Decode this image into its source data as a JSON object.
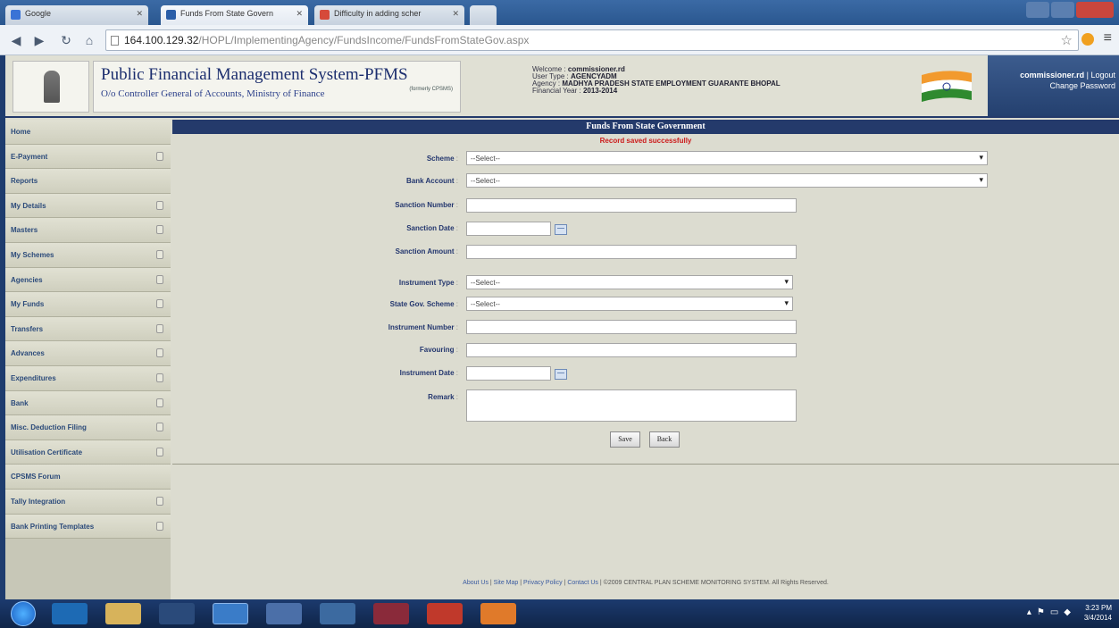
{
  "browser": {
    "tabs": [
      {
        "title": "Google",
        "color": "#3a73d6"
      },
      {
        "title": "Funds From State Govern",
        "color": "#2a5ea8"
      },
      {
        "title": "Difficulty in adding scher",
        "color": "#d64a3a"
      }
    ],
    "url_host": "164.100.129.32",
    "url_path": "/HOPL/ImplementingAgency/FundsIncome/FundsFromStateGov.aspx"
  },
  "header": {
    "title": "Public Financial Management System-PFMS",
    "subtitle": "O/o Controller General of Accounts, Ministry of Finance",
    "formerly": "(formerly CPSMS)",
    "welcome_label": "Welcome :",
    "welcome_value": "commissioner.rd",
    "user_type_label": "User Type :",
    "user_type_value": "AGENCYADM",
    "agency_label": "Agency :",
    "agency_value": "MADHYA PRADESH STATE EMPLOYMENT GUARANTE BHOPAL",
    "fy_label": "Financial Year :",
    "fy_value": "2013-2014",
    "user_link": "commissioner.rd",
    "logout": "Logout",
    "change_password": "Change Password"
  },
  "sidebar": {
    "items": [
      {
        "label": "Home",
        "arrow": false
      },
      {
        "label": "E-Payment",
        "arrow": true
      },
      {
        "label": "Reports",
        "arrow": false
      },
      {
        "label": "My Details",
        "arrow": true
      },
      {
        "label": "Masters",
        "arrow": true
      },
      {
        "label": "My Schemes",
        "arrow": true
      },
      {
        "label": "Agencies",
        "arrow": true
      },
      {
        "label": "My Funds",
        "arrow": true
      },
      {
        "label": "Transfers",
        "arrow": true
      },
      {
        "label": "Advances",
        "arrow": true
      },
      {
        "label": "Expenditures",
        "arrow": true
      },
      {
        "label": "Bank",
        "arrow": true
      },
      {
        "label": "Misc. Deduction Filing",
        "arrow": true
      },
      {
        "label": "Utilisation Certificate",
        "arrow": true
      },
      {
        "label": "CPSMS Forum",
        "arrow": false
      },
      {
        "label": "Tally Integration",
        "arrow": true
      },
      {
        "label": "Bank Printing Templates",
        "arrow": true
      }
    ]
  },
  "main": {
    "title": "Funds From State Government",
    "message": "Record saved successfully",
    "fields": {
      "scheme": {
        "label": "Scheme",
        "value": "--Select--"
      },
      "bank_account": {
        "label": "Bank Account",
        "value": "--Select--"
      },
      "sanction_number": {
        "label": "Sanction Number",
        "value": ""
      },
      "sanction_date": {
        "label": "Sanction Date",
        "value": ""
      },
      "sanction_amount": {
        "label": "Sanction Amount",
        "value": ""
      },
      "instrument_type": {
        "label": "Instrument Type",
        "value": "--Select--"
      },
      "state_gov_scheme": {
        "label": "State Gov. Scheme",
        "value": "--Select--"
      },
      "instrument_number": {
        "label": "Instrument Number",
        "value": ""
      },
      "favouring": {
        "label": "Favouring",
        "value": ""
      },
      "instrument_date": {
        "label": "Instrument Date",
        "value": ""
      },
      "remark": {
        "label": "Remark",
        "value": ""
      }
    },
    "save_label": "Save",
    "back_label": "Back"
  },
  "footer": {
    "about": "About Us",
    "sitemap": "Site Map",
    "privacy": "Privacy Policy",
    "contact": "Contact Us",
    "copyright": "©2009 CENTRAL PLAN SCHEME MONITORING SYSTEM. All Rights Reserved."
  },
  "taskbar": {
    "time": "3:23 PM",
    "date": "3/4/2014"
  }
}
